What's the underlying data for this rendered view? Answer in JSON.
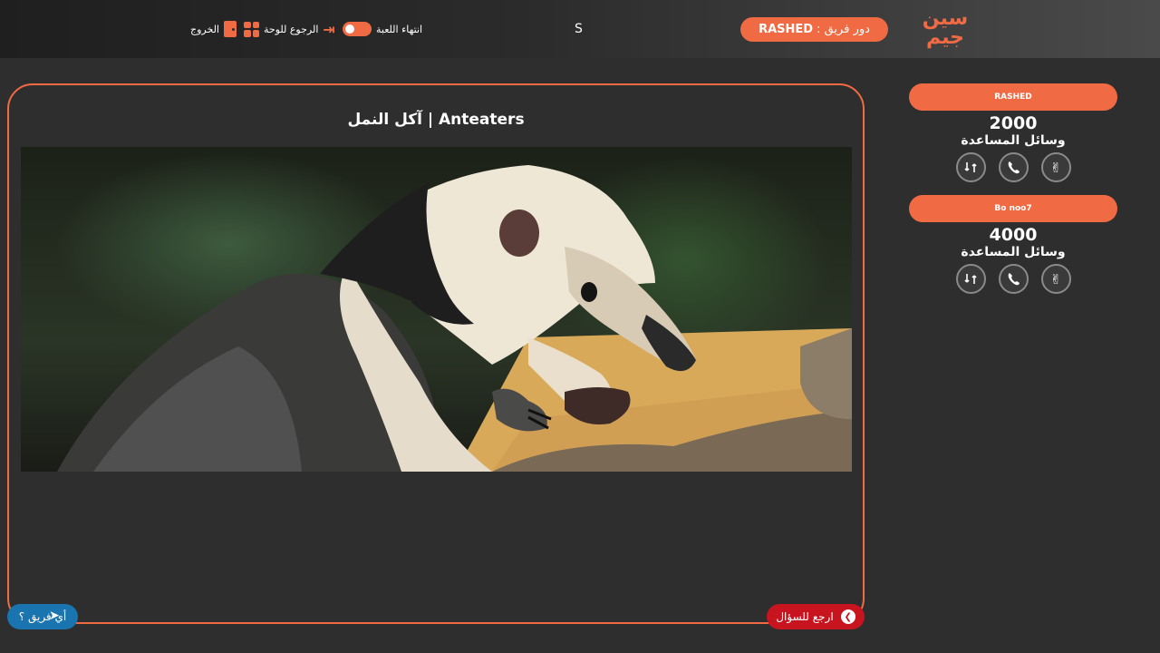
{
  "header": {
    "logo": {
      "line1": "سين",
      "line2": "جيم"
    },
    "turn_label": "دور فريق :",
    "turn_team": "RASHED",
    "timer": "S",
    "nav": {
      "end_game": "انتهاء اللعبة",
      "back_to_board": "الرجوع للوحة",
      "exit": "الخروج"
    }
  },
  "question": {
    "title": "آكل النمل | Anteaters",
    "image_icon": "anteater-photo"
  },
  "buttons": {
    "back_to_question": "ارجع للسؤال",
    "which_team": "أي فريق ؟"
  },
  "teams": [
    {
      "name": "RASHED",
      "score": "2000",
      "helpers_label": "وسائل المساعدة"
    },
    {
      "name": "Bo noo7",
      "score": "4000",
      "helpers_label": "وسائل المساعدة"
    }
  ],
  "helper_icons": [
    "two-answers-icon",
    "phone-call-icon",
    "swap-icon"
  ],
  "colors": {
    "accent": "#f06a43",
    "background": "#2e2e2e",
    "back_button": "#c8141e",
    "team_button": "#1a74b0"
  }
}
